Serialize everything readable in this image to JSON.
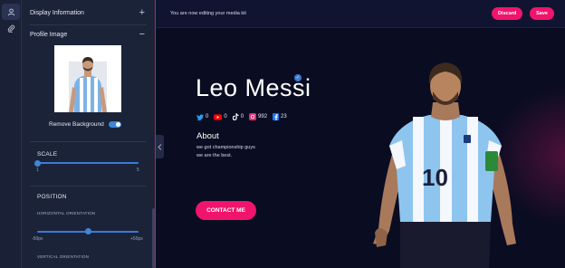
{
  "editor": {
    "sections": {
      "display_information": "Display Information",
      "profile_image": "Profile Image"
    },
    "remove_background_label": "Remove Background",
    "remove_background_enabled": true,
    "scale": {
      "label": "SCALE",
      "min_label": "1",
      "max_label": "5",
      "value_fraction": 0.0
    },
    "position": {
      "label": "POSITION",
      "horizontal_label": "HORIZONTAL ORIENTATION",
      "horizontal_min": "-50px",
      "horizontal_max": "+50px",
      "horizontal_value_fraction": 0.5,
      "vertical_label": "VERTICAL ORIENTATION"
    },
    "icons": [
      "user-icon",
      "paperclip-icon",
      "plus-icon",
      "minus-icon",
      "chevron-left-icon"
    ]
  },
  "topbar": {
    "status_text": "You are now editing your media kit",
    "discard_label": "Discard",
    "save_label": "Save"
  },
  "profile": {
    "name": "Leo Messi",
    "verified": true,
    "socials": [
      {
        "platform": "twitter",
        "count": "0",
        "color": "#1da1f2"
      },
      {
        "platform": "youtube",
        "count": "0",
        "color": "#ff0000"
      },
      {
        "platform": "tiktok",
        "count": "0",
        "color": "#ffffff"
      },
      {
        "platform": "instagram",
        "count": "992",
        "color": "#e1306c"
      },
      {
        "platform": "facebook",
        "count": "23",
        "color": "#1877f2"
      }
    ],
    "about_title": "About",
    "about_lines": [
      "we got championship guys",
      "we are the best."
    ],
    "contact_label": "CONTACT ME",
    "jersey_number": "10"
  },
  "colors": {
    "accent": "#f0146c",
    "slider": "#3e86d8",
    "panel_bg": "#1b2338",
    "preview_bg": "#0a0c22"
  }
}
